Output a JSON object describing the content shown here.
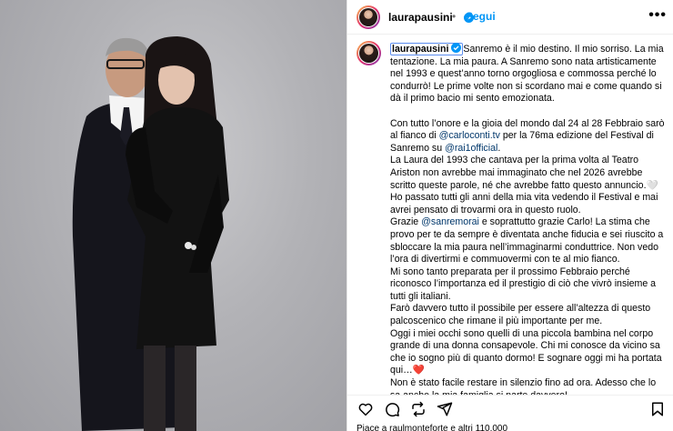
{
  "post": {
    "username": "laurapausini",
    "follow_label": "Segui",
    "separator": "•",
    "more_label": "•••"
  },
  "caption": {
    "username": "laurapausini",
    "paragraphs": [
      "Sanremo è il mio destino. Il mio sorriso. La mia tentazione. La mia paura. A Sanremo sono nata artisticamente nel 1993 e quest’anno torno orgogliosa e commossa perché lo condurrò! Le prime volte non si scordano mai e come quando si dà il primo bacio mi sento emozionata.",
      "",
      "Con tutto l’onore e la gioia del mondo dal 24 al 28 Febbraio sarò al fianco di",
      "La Laura del 1993 che cantava per la prima volta al Teatro Ariston non avrebbe mai immaginato che nel 2026 avrebbe scritto queste parole, né che avrebbe fatto questo annuncio.🤍",
      "Ho passato tutti gli anni della mia vita vedendo il Festival e mai avrei pensato di trovarmi ora in questo ruolo.",
      "Grazie",
      "Mi sono tanto preparata per il prossimo Febbraio perché riconosco l’importanza ed il prestigio di ciò che vivrò insieme a tutti gli italiani.",
      "Farò davvero tutto il possibile per essere all’altezza di questo palcoscenico che rimane il più importante per me.",
      "Oggi i miei occhi sono quelli di una piccola bambina nel corpo grande di una donna consapevole. Chi mi conosce da vicino sa che io sogno più di quanto dormo! E sognare oggi mi ha portata qui…❤️",
      "Non è stato facile restare in silenzio fino ad ora. Adesso che lo sa anche la mia famiglia,si parte davvero!"
    ],
    "mention_carlo": "@carloconti.tv",
    "text_after_carlo": " per la 76ma edizione del Festival di Sanremo su ",
    "mention_rai": "@rai1official",
    "text_after_rai": ".",
    "mention_sanremo": "@sanremorai",
    "text_after_sanremo": " e soprattutto grazie Carlo! La stima che provo per te da sempre è diventata anche fiducia e sei riuscito a sbloccare la mia paura nell’immaginarmi conduttrice. Non vedo l’ora di divertirmi e commuovermi con te al mio fianco."
  },
  "actions": {
    "like_icon": "heart-icon",
    "comment_icon": "comment-icon",
    "share_icon": "repost-icon",
    "send_icon": "send-icon",
    "save_icon": "bookmark-icon"
  },
  "likes_text": "Piace a raulmonteforte e altri 110.000",
  "colors": {
    "link": "#00376b",
    "follow": "#0095f6",
    "verified": "#0095f6",
    "heart": "#ed4956"
  }
}
